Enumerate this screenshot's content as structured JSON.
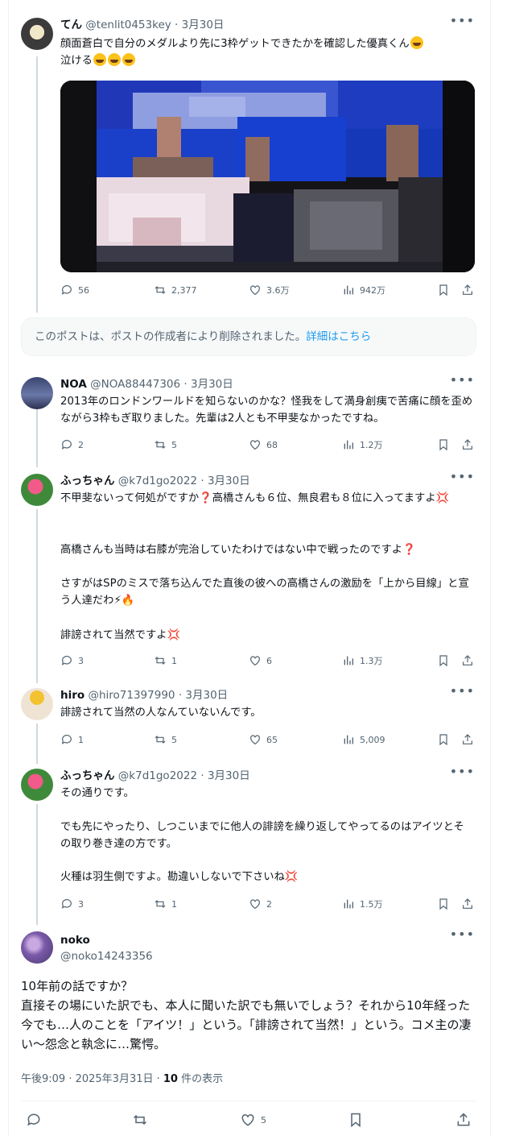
{
  "posts": [
    {
      "name": "てん",
      "handle": "@tenlit0453key",
      "date": "3月30日",
      "text_main": "顔面蒼白で自分のメダルより先に3枠ゲットできたかを確認した優真くん",
      "text_end": "泣ける",
      "replies": "56",
      "reposts": "2,377",
      "likes": "3.6万",
      "views": "942万"
    },
    {
      "name": "NOA",
      "handle": "@NOA88447306",
      "date": "3月30日",
      "text": "2013年のロンドンワールドを知らないのかな？怪我をして満身創痍で苦痛に顔を歪めながら3枠もぎ取りました。先輩は2人とも不甲斐なかったですね。",
      "replies": "2",
      "reposts": "5",
      "likes": "68",
      "views": "1.2万"
    },
    {
      "name": "ふっちゃん",
      "handle": "@k7d1go2022",
      "date": "3月30日",
      "line1": "不甲斐ないって何処がですか❓高橋さんも６位、無良君も８位に入ってますよ💢",
      "line2": "高橋さんも当時は右膝が完治していたわけではない中で戦ったのですよ❓",
      "line3": "さすがはSPのミスで落ち込んでた直後の彼への高橋さんの激励を「上から目線」と宣う人達だわ⚡🔥",
      "line4": "誹謗されて当然ですよ💢",
      "replies": "3",
      "reposts": "1",
      "likes": "6",
      "views": "1.3万"
    },
    {
      "name": "hiro",
      "handle": "@hiro71397990",
      "date": "3月30日",
      "text": "誹謗されて当然の人なんていないんです。",
      "replies": "1",
      "reposts": "5",
      "likes": "65",
      "views": "5,009"
    },
    {
      "name": "ふっちゃん",
      "handle": "@k7d1go2022",
      "date": "3月30日",
      "line1": "その通りです。",
      "line2": "でも先にやったり、しつこいまでに他人の誹謗を繰り返してやってるのはアイツとその取り巻き達の方です。",
      "line3": "火種は羽生側ですよ。勘違いしないで下さいね💢",
      "replies": "3",
      "reposts": "1",
      "likes": "2",
      "views": "1.5万"
    }
  ],
  "deleted_notice": {
    "text": "このポストは、ポストの作成者により削除されました。",
    "link": "詳細はこちら"
  },
  "focus": {
    "name": "noko",
    "handle": "@noko14243356",
    "text": "10年前の話ですか？\n直接その場にいた訳でも、本人に聞いた訳でも無いでしょう？それから10年経った今でも…人のことを「アイツ！」という。「誹謗されて当然！」という。コメ主の凄い〜怨念と執念に…驚愕。",
    "timestamp": "午後9:09 · 2025年3月31日 · ",
    "views_count": "10",
    "views_label": " 件の表示",
    "likes": "5"
  },
  "icons": [
    "reply-icon",
    "repost-icon",
    "like-icon",
    "views-icon",
    "bookmark-icon",
    "share-icon",
    "more-icon"
  ]
}
